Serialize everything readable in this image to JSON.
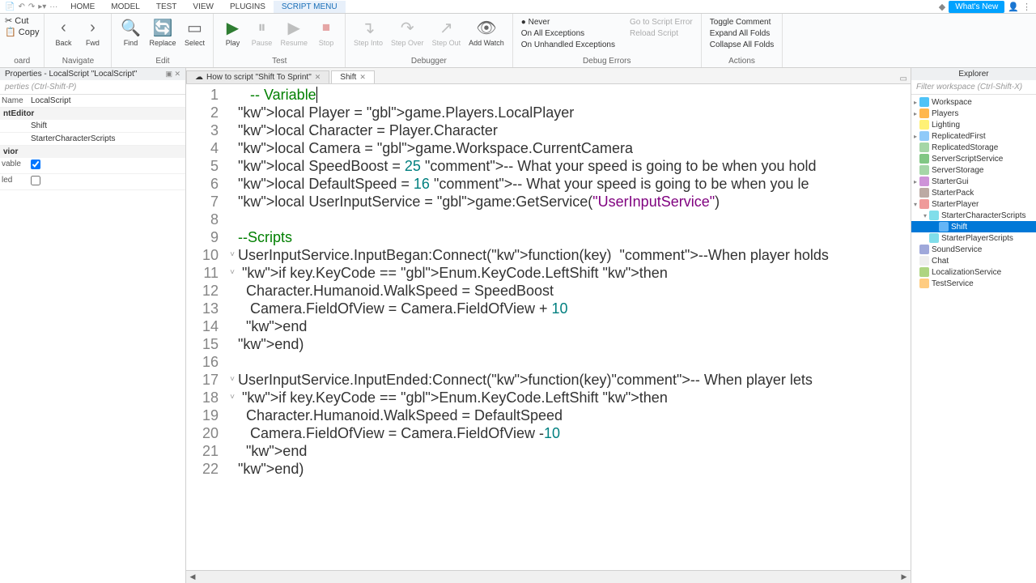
{
  "menu": {
    "tabs": [
      "HOME",
      "MODEL",
      "TEST",
      "VIEW",
      "PLUGINS",
      "SCRIPT MENU"
    ],
    "active": 5,
    "whatsnew": "What's New"
  },
  "ribbon": {
    "clipboard": {
      "label": "oard",
      "cut": "Cut",
      "copy": "Copy"
    },
    "navigate": {
      "label": "Navigate",
      "back": "Back",
      "fwd": "Fwd"
    },
    "edit": {
      "label": "Edit",
      "find": "Find",
      "replace": "Replace",
      "select": "Select"
    },
    "test": {
      "label": "Test",
      "play": "Play",
      "pause": "Pause",
      "resume": "Resume",
      "stop": "Stop"
    },
    "debugger": {
      "label": "Debugger",
      "stepinto": "Step\nInto",
      "stepover": "Step\nOver",
      "stepout": "Step\nOut",
      "addwatch": "Add\nWatch"
    },
    "errors": {
      "never": "Never",
      "allexc": "On All Exceptions",
      "unhandled": "On Unhandled Exceptions",
      "debugerrors": "Debug Errors",
      "gotoerr": "Go to Script Error",
      "reload": "Reload Script"
    },
    "actions": {
      "label": "Actions",
      "toggle": "Toggle Comment",
      "expand": "Expand All Folds",
      "collapse": "Collapse All Folds"
    }
  },
  "properties": {
    "title": "Properties - LocalScript \"LocalScript\"",
    "filter": "perties (Ctrl-Shift-P)",
    "rows": [
      {
        "name": "Name",
        "val": "LocalScript"
      },
      {
        "name": "",
        "val": "Shift"
      },
      {
        "name": "",
        "val": "StarterCharacterScripts"
      }
    ],
    "vable": "vable",
    "led": "led"
  },
  "editor": {
    "tabs": [
      {
        "label": "How to script \"Shift To Sprint\"",
        "icon": "☁"
      },
      {
        "label": "Shift",
        "icon": ""
      }
    ],
    "activeTab": 1,
    "code": [
      {
        "n": 1,
        "t": "comment",
        "c": "   -- Variable"
      },
      {
        "n": 2,
        "c": "local Player = game.Players.LocalPlayer"
      },
      {
        "n": 3,
        "c": "local Character = Player.Character"
      },
      {
        "n": 4,
        "c": "local Camera = game.Workspace.CurrentCamera"
      },
      {
        "n": 5,
        "c": "local SpeedBoost = 25 -- What your speed is going to be when you hold"
      },
      {
        "n": 6,
        "c": "local DefaultSpeed = 16 -- What your speed is going to be when you le"
      },
      {
        "n": 7,
        "c": "local UserInputService = game:GetService(\"UserInputService\")"
      },
      {
        "n": 8,
        "c": ""
      },
      {
        "n": 9,
        "t": "comment",
        "c": "--Scripts"
      },
      {
        "n": 10,
        "c": "UserInputService.InputBegan:Connect(function(key)  --When player holds"
      },
      {
        "n": 11,
        "c": " if key.KeyCode == Enum.KeyCode.LeftShift then"
      },
      {
        "n": 12,
        "c": "  Character.Humanoid.WalkSpeed = SpeedBoost"
      },
      {
        "n": 13,
        "c": "   Camera.FieldOfView = Camera.FieldOfView + 10"
      },
      {
        "n": 14,
        "c": "  end"
      },
      {
        "n": 15,
        "c": "end)"
      },
      {
        "n": 16,
        "c": ""
      },
      {
        "n": 17,
        "c": "UserInputService.InputEnded:Connect(function(key)-- When player lets"
      },
      {
        "n": 18,
        "c": " if key.KeyCode == Enum.KeyCode.LeftShift then"
      },
      {
        "n": 19,
        "c": "  Character.Humanoid.WalkSpeed = DefaultSpeed"
      },
      {
        "n": 20,
        "c": "   Camera.FieldOfView = Camera.FieldOfView -10"
      },
      {
        "n": 21,
        "c": "  end"
      },
      {
        "n": 22,
        "c": "end)"
      }
    ]
  },
  "explorer": {
    "title": "Explorer",
    "filter": "Filter workspace (Ctrl-Shift-X)",
    "tree": [
      {
        "d": 0,
        "exp": "▸",
        "ico": "ico-workspace",
        "label": "Workspace"
      },
      {
        "d": 0,
        "exp": "▸",
        "ico": "ico-players",
        "label": "Players"
      },
      {
        "d": 0,
        "exp": "",
        "ico": "ico-lighting",
        "label": "Lighting"
      },
      {
        "d": 0,
        "exp": "▸",
        "ico": "ico-folder",
        "label": "ReplicatedFirst"
      },
      {
        "d": 0,
        "exp": "",
        "ico": "ico-storage",
        "label": "ReplicatedStorage"
      },
      {
        "d": 0,
        "exp": "",
        "ico": "ico-script",
        "label": "ServerScriptService"
      },
      {
        "d": 0,
        "exp": "",
        "ico": "ico-storage",
        "label": "ServerStorage"
      },
      {
        "d": 0,
        "exp": "▸",
        "ico": "ico-gui",
        "label": "StarterGui"
      },
      {
        "d": 0,
        "exp": "",
        "ico": "ico-pack",
        "label": "StarterPack"
      },
      {
        "d": 0,
        "exp": "▾",
        "ico": "ico-player",
        "label": "StarterPlayer"
      },
      {
        "d": 1,
        "exp": "▾",
        "ico": "ico-starter",
        "label": "StarterCharacterScripts"
      },
      {
        "d": 2,
        "exp": "",
        "ico": "ico-localscript",
        "label": "Shift",
        "sel": true
      },
      {
        "d": 1,
        "exp": "",
        "ico": "ico-starter",
        "label": "StarterPlayerScripts"
      },
      {
        "d": 0,
        "exp": "",
        "ico": "ico-sound",
        "label": "SoundService"
      },
      {
        "d": 0,
        "exp": "",
        "ico": "ico-chat",
        "label": "Chat"
      },
      {
        "d": 0,
        "exp": "",
        "ico": "ico-local",
        "label": "LocalizationService"
      },
      {
        "d": 0,
        "exp": "",
        "ico": "ico-test",
        "label": "TestService"
      }
    ]
  }
}
